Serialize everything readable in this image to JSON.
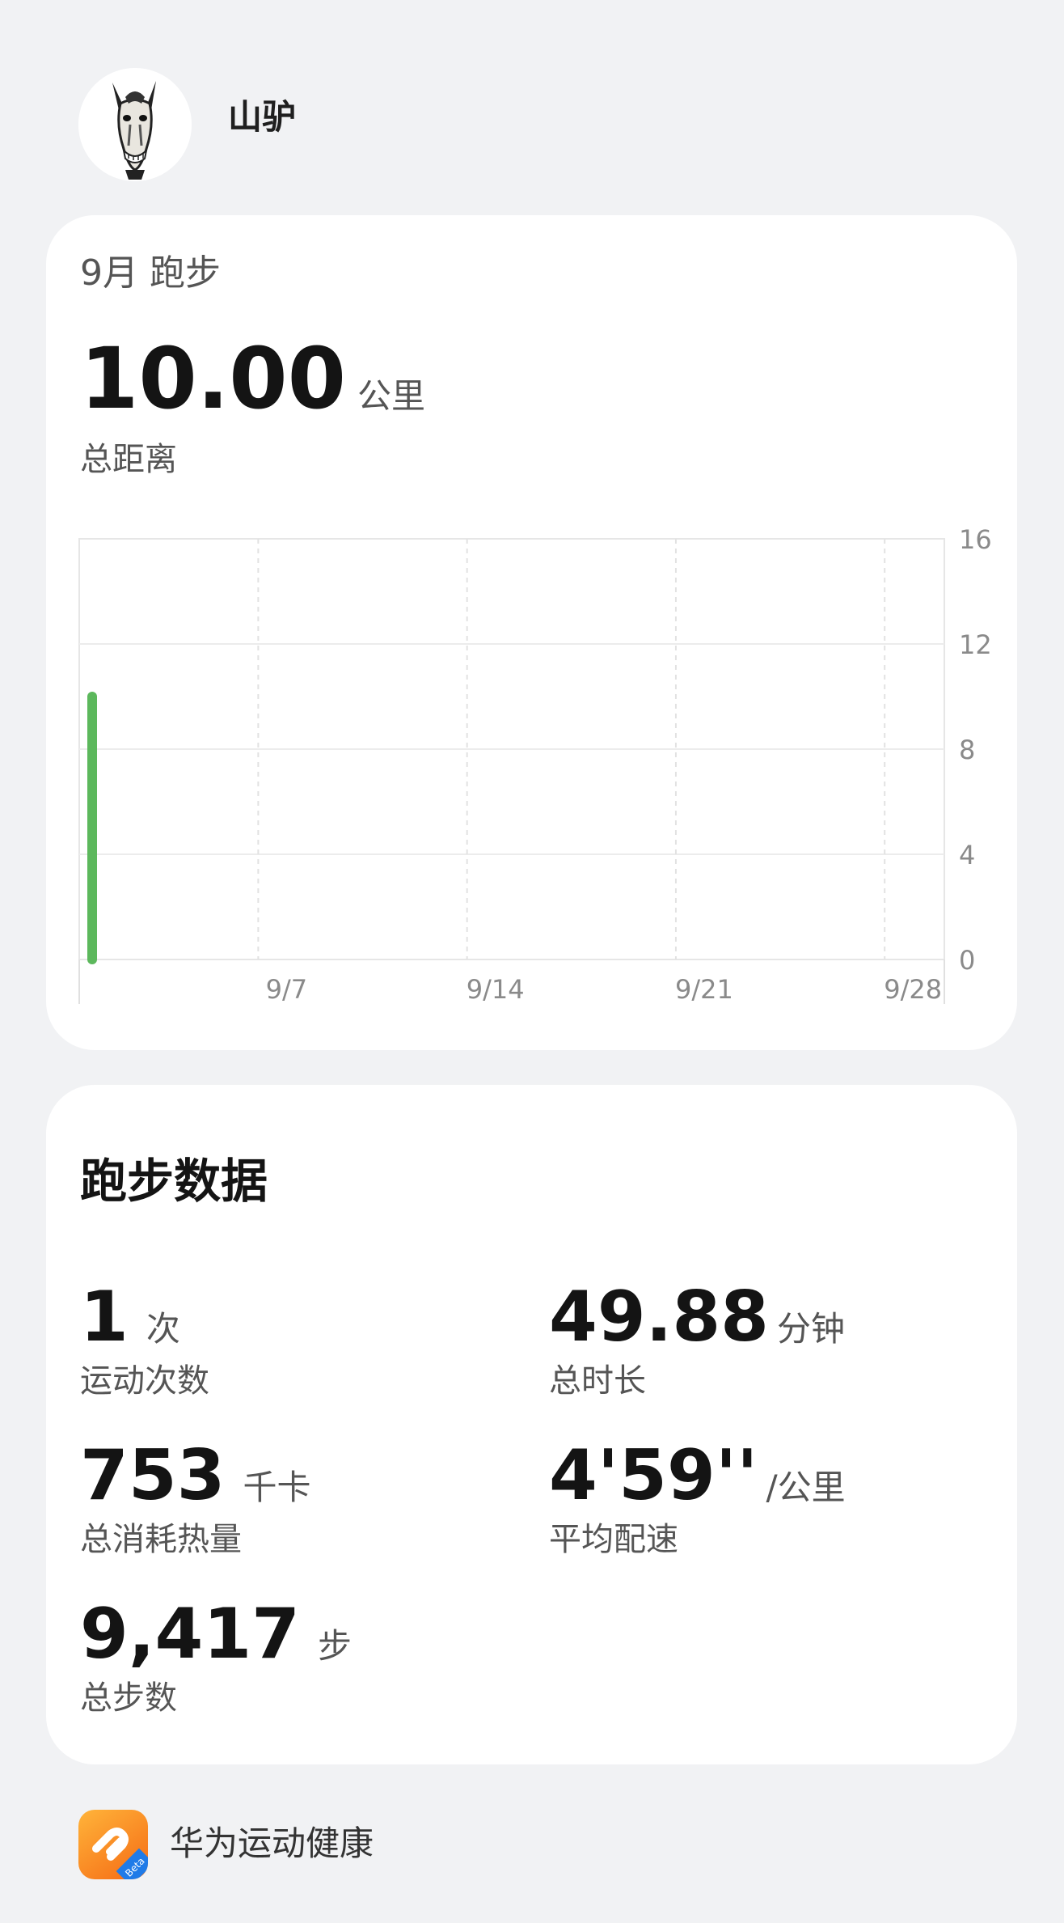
{
  "profile": {
    "username": "山驴"
  },
  "month_card": {
    "title": "9月 跑步",
    "total_distance": "10.00",
    "distance_unit": "公里",
    "distance_label": "总距离"
  },
  "chart_data": {
    "type": "bar",
    "x_tick_labels": [
      "9/7",
      "9/14",
      "9/21",
      "9/28"
    ],
    "y_tick_labels": [
      "16",
      "12",
      "8",
      "4",
      "0"
    ],
    "ylim": [
      0,
      16
    ],
    "xlim": [
      1,
      30
    ],
    "points": [
      {
        "x": 1,
        "y": 10
      }
    ],
    "bar_color": "#5cb85c",
    "grid": true,
    "y_axis_side": "right"
  },
  "stats": {
    "section_title": "跑步数据",
    "items": [
      {
        "value": "1",
        "unit": "次",
        "label": "运动次数"
      },
      {
        "value": "49.88",
        "unit": "分钟",
        "label": "总时长"
      },
      {
        "value": "753",
        "unit": "千卡",
        "label": "总消耗热量"
      },
      {
        "value": "4'59''",
        "unit": "/公里",
        "label": "平均配速"
      },
      {
        "value": "9,417",
        "unit": "步",
        "label": "总步数"
      }
    ]
  },
  "footer": {
    "app_name": "华为运动健康",
    "badge": "Beta",
    "icon": "huawei-health-app-icon"
  }
}
